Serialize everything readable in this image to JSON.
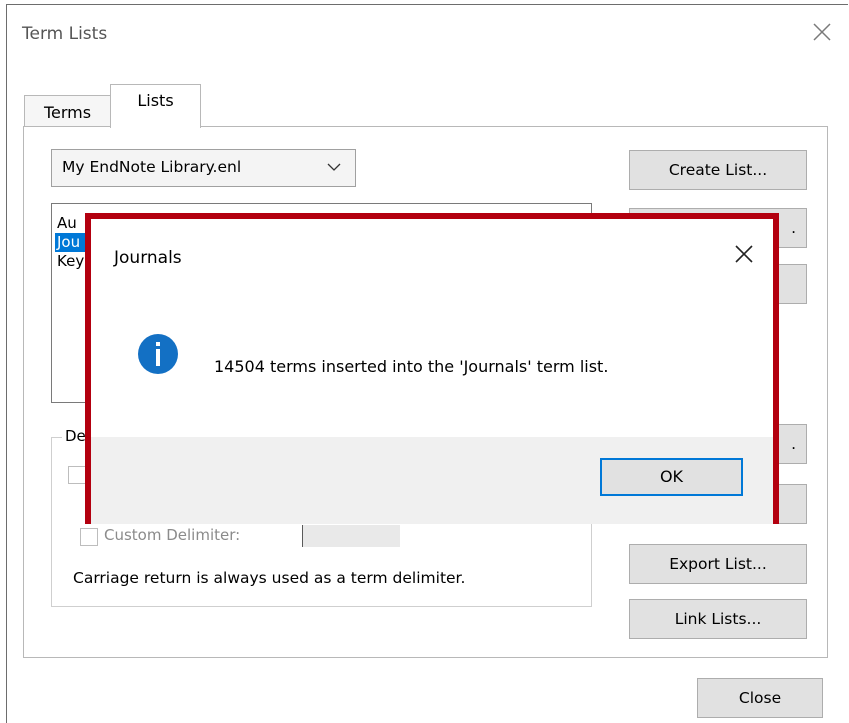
{
  "window": {
    "title": "Term Lists",
    "tabs": [
      {
        "label": "Terms",
        "active": false
      },
      {
        "label": "Lists",
        "active": true
      }
    ]
  },
  "lists_tab": {
    "library_select": "My EndNote Library.enl",
    "list_items": [
      "Au",
      "Jou",
      "Key"
    ],
    "selected_index": 1,
    "delimiters_legend": "De",
    "custom_delimiter_label": "Custom Delimiter:",
    "note": "Carriage return is always used as a term delimiter."
  },
  "buttons": {
    "create_list": "Create List...",
    "rename_list_partial": ".",
    "delete_list_partial": "",
    "update_list_partial": ".",
    "import_list_partial": "",
    "export_list": "Export List...",
    "link_lists": "Link Lists...",
    "close": "Close"
  },
  "dialog": {
    "title": "Journals",
    "message": "14504 terms inserted into the 'Journals' term list.",
    "ok": "OK",
    "icon": "info-icon"
  },
  "colors": {
    "selection": "#0078d7",
    "highlight_border": "#b3000f",
    "info_icon": "#1370c4"
  }
}
